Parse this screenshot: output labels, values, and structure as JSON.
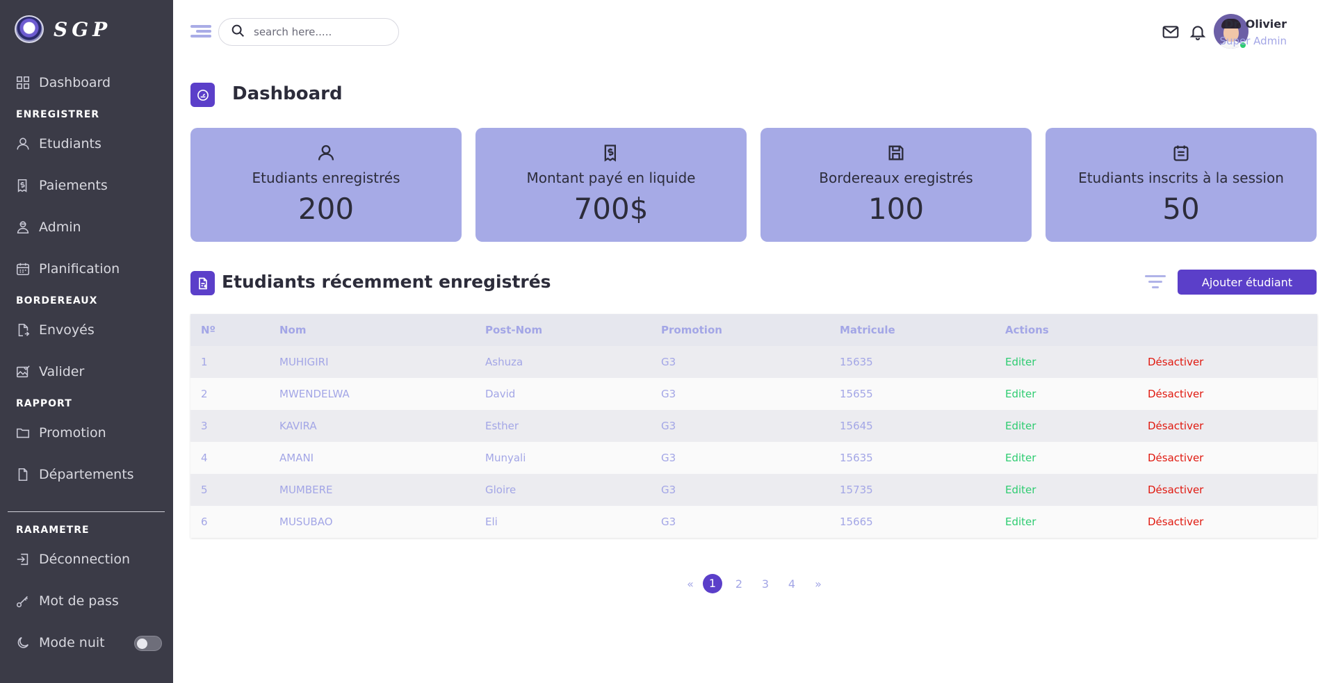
{
  "brand": {
    "logo_text": "SGP"
  },
  "sidebar": {
    "dashboard": "Dashboard",
    "section_enregistrer": "ENREGISTRER",
    "etudiants": "Etudiants",
    "paiements": "Paiements",
    "admin": "Admin",
    "planification": "Planification",
    "section_bordereaux": "BORDEREAUX",
    "envoyes": "Envoyés",
    "valider": "Valider",
    "section_rapport": "RAPPORT",
    "promotion": "Promotion",
    "departements": "Départements",
    "section_parametre": "RARAMETRE",
    "deconnexion": "Déconnection",
    "mot_de_pass": "Mot de pass",
    "mode_nuit": "Mode nuit",
    "mode_nuit_on": false
  },
  "header": {
    "search_placeholder": "search here.....",
    "user_name": "Dr. Olivier",
    "user_role": "Super Admin"
  },
  "page": {
    "title": "Dashboard"
  },
  "cards": [
    {
      "label": "Etudiants enregistrés",
      "value": "200"
    },
    {
      "label": "Montant payé en liquide",
      "value": "700$"
    },
    {
      "label": "Bordereaux eregistrés",
      "value": "100"
    },
    {
      "label": "Etudiants inscrits à la session",
      "value": "50"
    }
  ],
  "recent": {
    "title": "Etudiants récemment enregistrés",
    "add_button": "Ajouter étudiant",
    "columns": [
      "Nº",
      "Nom",
      "Post-Nom",
      "Promotion",
      "Matricule",
      "Actions"
    ],
    "rows": [
      {
        "n": "1",
        "nom": "MUHIGIRI",
        "postnom": "Ashuza",
        "promotion": "G3",
        "matricule": "15635",
        "edit": "Editer",
        "deact": "Désactiver"
      },
      {
        "n": "2",
        "nom": "MWENDELWA",
        "postnom": "David",
        "promotion": "G3",
        "matricule": "15655",
        "edit": "Editer",
        "deact": "Désactiver"
      },
      {
        "n": "3",
        "nom": "KAVIRA",
        "postnom": "Esther",
        "promotion": "G3",
        "matricule": "15645",
        "edit": "Editer",
        "deact": "Désactiver"
      },
      {
        "n": "4",
        "nom": "AMANI",
        "postnom": "Munyali",
        "promotion": "G3",
        "matricule": "15635",
        "edit": "Editer",
        "deact": "Désactiver"
      },
      {
        "n": "5",
        "nom": "MUMBERE",
        "postnom": "Gloire",
        "promotion": "G3",
        "matricule": "15735",
        "edit": "Editer",
        "deact": "Désactiver"
      },
      {
        "n": "6",
        "nom": "MUSUBAO",
        "postnom": "Eli",
        "promotion": "G3",
        "matricule": "15665",
        "edit": "Editer",
        "deact": "Désactiver"
      }
    ]
  },
  "pagination": {
    "prev": "«",
    "pages": [
      "1",
      "2",
      "3",
      "4"
    ],
    "current": "1",
    "next": "»"
  },
  "colors": {
    "accent": "#5b3fc9",
    "card": "#a6aae6",
    "sidebar": "#3b3b47",
    "edit": "#2ecc71",
    "deactivate": "#e0190f"
  }
}
